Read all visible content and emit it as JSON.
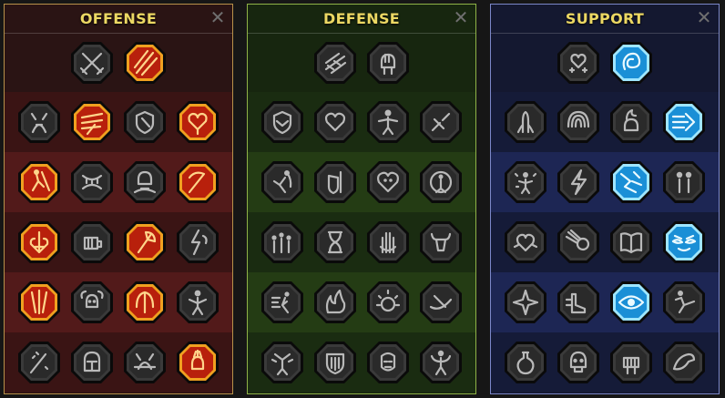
{
  "panels": [
    {
      "key": "offense",
      "title": "OFFENSE",
      "close_label": "✕",
      "top": [
        {
          "icon": "crossed-swords-icon",
          "active": false
        },
        {
          "icon": "blades-slash-icon",
          "active": true
        }
      ],
      "rows": [
        [
          {
            "icon": "fiend-icon",
            "active": false
          },
          {
            "icon": "claw-strike-icon",
            "active": true
          },
          {
            "icon": "shield-breaker-icon",
            "active": false
          },
          {
            "icon": "bleeding-heart-icon",
            "active": true
          }
        ],
        [
          {
            "icon": "warrior-strike-icon",
            "active": true
          },
          {
            "icon": "jaws-icon",
            "active": false
          },
          {
            "icon": "skull-smoke-icon",
            "active": false
          },
          {
            "icon": "scythe-icon",
            "active": true
          }
        ],
        [
          {
            "icon": "heart-sword-icon",
            "active": true
          },
          {
            "icon": "fist-icon",
            "active": false
          },
          {
            "icon": "axe-icon",
            "active": true
          },
          {
            "icon": "lightning-chain-icon",
            "active": false
          }
        ],
        [
          {
            "icon": "triple-slash-icon",
            "active": true
          },
          {
            "icon": "skull-cloud-icon",
            "active": false
          },
          {
            "icon": "blade-arc-icon",
            "active": true
          },
          {
            "icon": "brute-icon",
            "active": false
          }
        ],
        [
          {
            "icon": "sword-sparks-icon",
            "active": false
          },
          {
            "icon": "knight-helm-icon",
            "active": false
          },
          {
            "icon": "demon-icon",
            "active": false
          },
          {
            "icon": "flaming-skull-icon",
            "active": true
          }
        ]
      ]
    },
    {
      "key": "defense",
      "title": "DEFENSE",
      "close_label": "✕",
      "top": [
        {
          "icon": "bricks-icon",
          "active": false
        },
        {
          "icon": "raised-fist-icon",
          "active": false
        }
      ],
      "rows": [
        [
          {
            "icon": "chevron-shield-icon",
            "active": false
          },
          {
            "icon": "heart-icon",
            "active": false
          },
          {
            "icon": "titan-icon",
            "active": false
          },
          {
            "icon": "broken-blade-icon",
            "active": false
          }
        ],
        [
          {
            "icon": "dodge-figure-icon",
            "active": false
          },
          {
            "icon": "shield-bearer-icon",
            "active": false
          },
          {
            "icon": "heart-skull-icon",
            "active": false
          },
          {
            "icon": "halo-figure-icon",
            "active": false
          }
        ],
        [
          {
            "icon": "crowd-icon",
            "active": false
          },
          {
            "icon": "hourglass-icon",
            "active": false
          },
          {
            "icon": "open-hand-icon",
            "active": false
          },
          {
            "icon": "bull-head-icon",
            "active": false
          }
        ],
        [
          {
            "icon": "sprint-figure-icon",
            "active": false
          },
          {
            "icon": "flames-icon",
            "active": false
          },
          {
            "icon": "sun-skull-icon",
            "active": false
          },
          {
            "icon": "deflect-icon",
            "active": false
          }
        ],
        [
          {
            "icon": "rage-icon",
            "active": false
          },
          {
            "icon": "bulwark-icon",
            "active": false
          },
          {
            "icon": "iron-mask-icon",
            "active": false
          },
          {
            "icon": "strongman-icon",
            "active": false
          }
        ]
      ]
    },
    {
      "key": "support",
      "title": "SUPPORT",
      "close_label": "✕",
      "top": [
        {
          "icon": "heart-plus-icon",
          "active": false
        },
        {
          "icon": "swirl-icon",
          "active": true
        }
      ],
      "rows": [
        [
          {
            "icon": "praying-hands-icon",
            "active": false
          },
          {
            "icon": "shield-arcs-icon",
            "active": false
          },
          {
            "icon": "flame-skull-icon",
            "active": false
          },
          {
            "icon": "speed-arrow-icon",
            "active": true
          }
        ],
        [
          {
            "icon": "sparkle-figure-icon",
            "active": false
          },
          {
            "icon": "lightning-bolt-icon",
            "active": false
          },
          {
            "icon": "crumble-icon",
            "active": true
          },
          {
            "icon": "duo-figure-icon",
            "active": false
          }
        ],
        [
          {
            "icon": "chained-heart-icon",
            "active": false
          },
          {
            "icon": "comet-icon",
            "active": false
          },
          {
            "icon": "open-book-icon",
            "active": false
          },
          {
            "icon": "fierce-eyes-icon",
            "active": true
          }
        ],
        [
          {
            "icon": "compass-star-icon",
            "active": false
          },
          {
            "icon": "swift-boot-icon",
            "active": false
          },
          {
            "icon": "all-seeing-eye-icon",
            "active": true
          },
          {
            "icon": "kick-figure-icon",
            "active": false
          }
        ],
        [
          {
            "icon": "potion-icon",
            "active": false
          },
          {
            "icon": "skull-icon",
            "active": false
          },
          {
            "icon": "grip-icon",
            "active": false
          },
          {
            "icon": "eagle-icon",
            "active": false
          }
        ]
      ]
    }
  ]
}
